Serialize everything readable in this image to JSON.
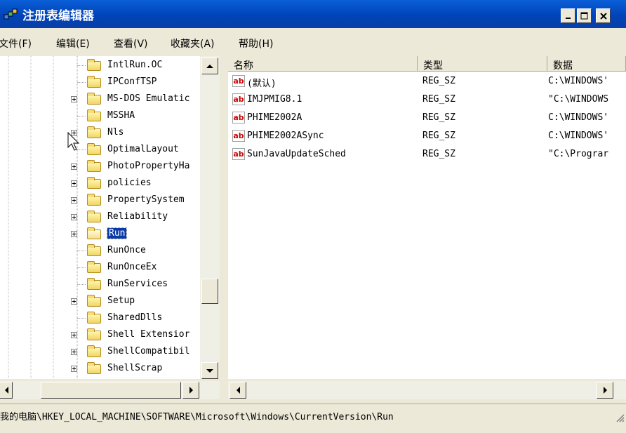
{
  "window": {
    "title": "注册表编辑器"
  },
  "menu": [
    "文件(F)",
    "编辑(E)",
    "查看(V)",
    "收藏夹(A)",
    "帮助(H)"
  ],
  "tree": [
    {
      "label": "IntlRun.OC",
      "expander": false,
      "selected": false
    },
    {
      "label": "IPConfTSP",
      "expander": false,
      "selected": false
    },
    {
      "label": "MS-DOS Emulatic",
      "expander": true,
      "selected": false
    },
    {
      "label": "MSSHA",
      "expander": false,
      "selected": false
    },
    {
      "label": "Nls",
      "expander": true,
      "selected": false
    },
    {
      "label": "OptimalLayout",
      "expander": false,
      "selected": false
    },
    {
      "label": "PhotoPropertyHa",
      "expander": true,
      "selected": false
    },
    {
      "label": "policies",
      "expander": true,
      "selected": false
    },
    {
      "label": "PropertySystem",
      "expander": true,
      "selected": false
    },
    {
      "label": "Reliability",
      "expander": true,
      "selected": false
    },
    {
      "label": "Run",
      "expander": true,
      "selected": true
    },
    {
      "label": "RunOnce",
      "expander": false,
      "selected": false
    },
    {
      "label": "RunOnceEx",
      "expander": false,
      "selected": false
    },
    {
      "label": "RunServices",
      "expander": false,
      "selected": false
    },
    {
      "label": "Setup",
      "expander": true,
      "selected": false
    },
    {
      "label": "SharedDlls",
      "expander": false,
      "selected": false
    },
    {
      "label": "Shell Extensior",
      "expander": true,
      "selected": false
    },
    {
      "label": "ShellCompatibil",
      "expander": true,
      "selected": false
    },
    {
      "label": "ShellScrap",
      "expander": true,
      "selected": false
    }
  ],
  "columns": [
    "名称",
    "类型",
    "数据"
  ],
  "values": [
    {
      "icon": "ab",
      "name": "(默认)",
      "type": "REG_SZ",
      "data": "C:\\WINDOWS'"
    },
    {
      "icon": "ab",
      "name": "IMJPMIG8.1",
      "type": "REG_SZ",
      "data": "\"C:\\WINDOWS"
    },
    {
      "icon": "ab",
      "name": "PHIME2002A",
      "type": "REG_SZ",
      "data": "C:\\WINDOWS'"
    },
    {
      "icon": "ab",
      "name": "PHIME2002ASync",
      "type": "REG_SZ",
      "data": "C:\\WINDOWS'"
    },
    {
      "icon": "ab",
      "name": "SunJavaUpdateSched",
      "type": "REG_SZ",
      "data": "\"C:\\Prograr"
    }
  ],
  "status": {
    "path": "我的电脑\\HKEY_LOCAL_MACHINE\\SOFTWARE\\Microsoft\\Windows\\CurrentVersion\\Run"
  },
  "colors": {
    "title_bar": "#0043b8",
    "selection": "#0a3aa8",
    "chrome": "#ece9d8"
  }
}
